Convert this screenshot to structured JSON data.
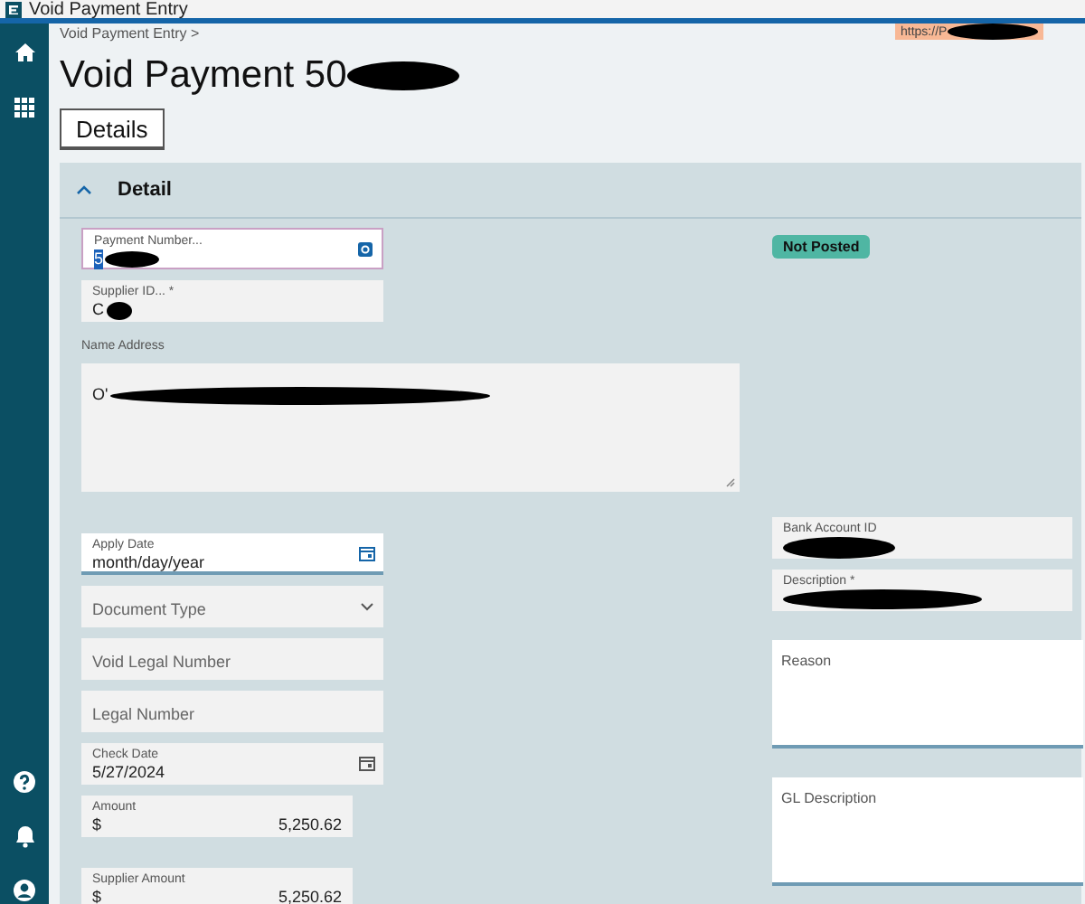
{
  "window": {
    "title": "Void Payment Entry"
  },
  "url_tooltip": "https://P",
  "sidebar": {
    "top_items": [
      {
        "kind": "home"
      },
      {
        "kind": "apps"
      }
    ],
    "bottom_items": [
      {
        "kind": "help"
      },
      {
        "kind": "notifications"
      },
      {
        "kind": "account"
      }
    ]
  },
  "breadcrumb": "Void Payment Entry",
  "breadcrumb_separator": ">",
  "page_title": "Void Payment 50",
  "tabs": [
    {
      "label": "Details",
      "selected": true
    }
  ],
  "panel": {
    "title": "Detail",
    "expanded": true,
    "status_badge": "Not Posted",
    "payment_number": {
      "label": "Payment Number...",
      "value": "5"
    },
    "supplier_id": {
      "label": "Supplier ID... *",
      "value": "C"
    },
    "name_address": {
      "label": "Name Address",
      "value": "O'"
    },
    "apply_date": {
      "label": "Apply Date",
      "placeholder": "month/day/year"
    },
    "document_type": {
      "placeholder": "Document Type"
    },
    "void_legal_number": {
      "placeholder": "Void Legal Number"
    },
    "legal_number": {
      "placeholder": "Legal Number"
    },
    "check_date": {
      "label": "Check Date",
      "value": "5/27/2024"
    },
    "amount": {
      "label": "Amount",
      "currency": "$",
      "value": "5,250.62"
    },
    "supplier_amount": {
      "label": "Supplier Amount",
      "currency": "$",
      "value": "5,250.62"
    },
    "bank_account_id": {
      "label": "Bank Account ID"
    },
    "description": {
      "label": "Description *"
    },
    "reason": {
      "placeholder": "Reason"
    },
    "gl_description": {
      "placeholder": "GL Description"
    }
  }
}
